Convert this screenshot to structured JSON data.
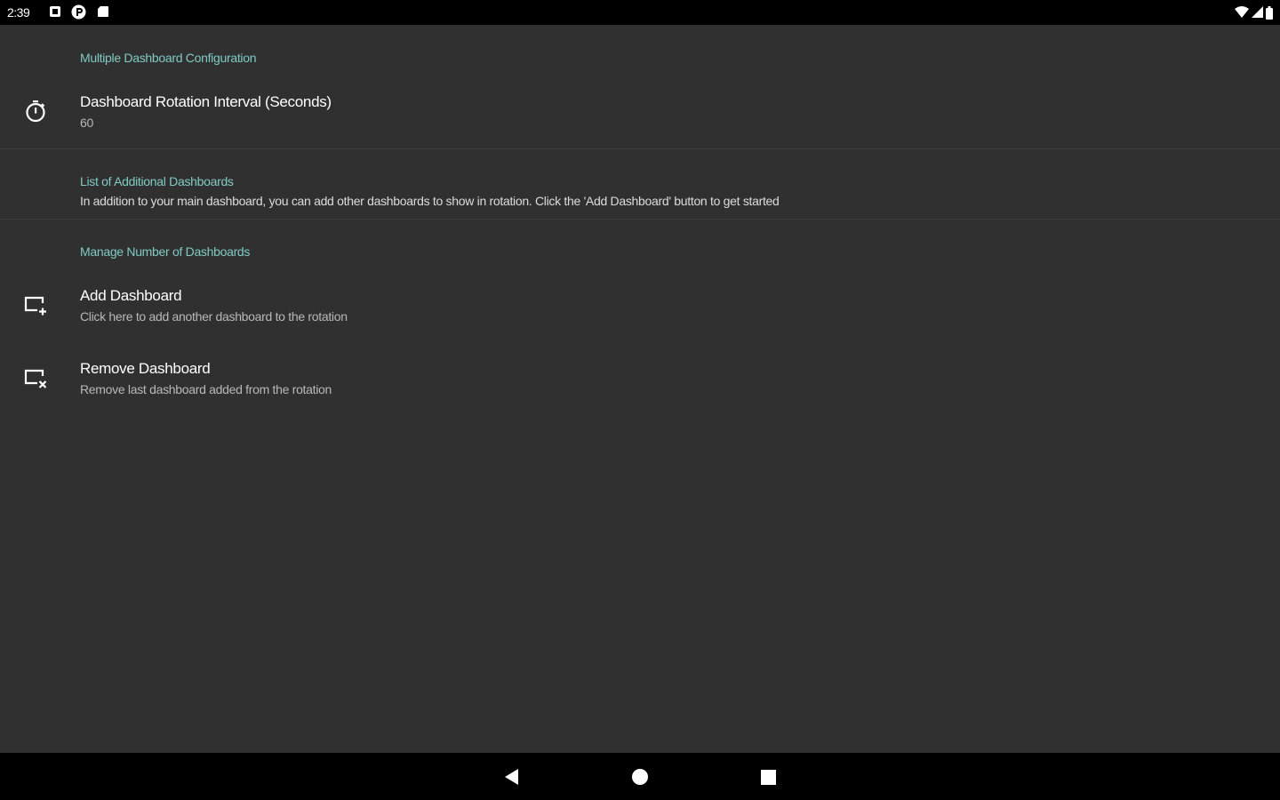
{
  "status_bar": {
    "time": "2:39",
    "notification_icons": [
      "square-notification-icon",
      "p-circle-notification-icon",
      "sd-card-icon"
    ],
    "right_icons": [
      "wifi-icon",
      "cell-signal-icon",
      "battery-icon"
    ]
  },
  "settings": {
    "multiple_config": {
      "category_title": "Multiple Dashboard Configuration",
      "rotation_interval": {
        "title": "Dashboard Rotation Interval (Seconds)",
        "value": "60",
        "icon": "timer-icon"
      }
    },
    "additional_list": {
      "category_title": "List of Additional Dashboards",
      "description": "In addition to your main dashboard, you can add other dashboards to show in rotation. Click the 'Add Dashboard' button to get started"
    },
    "manage": {
      "category_title": "Manage Number of Dashboards",
      "add": {
        "title": "Add Dashboard",
        "summary": "Click here to add another dashboard to the rotation",
        "icon": "add-dashboard-icon"
      },
      "remove": {
        "title": "Remove Dashboard",
        "summary": "Remove last dashboard added from the rotation",
        "icon": "remove-dashboard-icon"
      }
    }
  },
  "nav_bar": {
    "buttons": [
      "back-icon",
      "home-icon",
      "recents-icon"
    ]
  },
  "colors": {
    "background": "#303030",
    "accent": "#80cbc4",
    "bars": "#000000"
  }
}
